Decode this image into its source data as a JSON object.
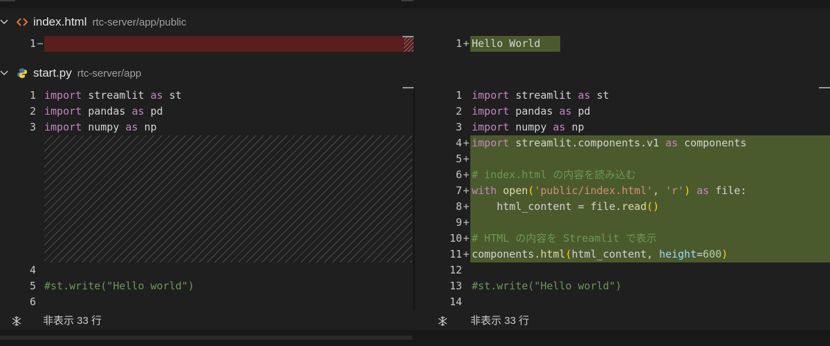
{
  "files": [
    {
      "name": "index.html",
      "path": "rtc-server/app/public",
      "icon": "html-file-icon",
      "left_lines": [
        {
          "n": "1",
          "mark": "−",
          "text": ""
        }
      ],
      "right_lines": [
        {
          "n": "1",
          "mark": "+",
          "text": "Hello World"
        }
      ]
    },
    {
      "name": "start.py",
      "path": "rtc-server/app",
      "icon": "python-file-icon",
      "left_numbers": [
        "1",
        "2",
        "3",
        "4",
        "5",
        "6"
      ],
      "right_numbers": [
        "1",
        "2",
        "3",
        "4",
        "5",
        "6",
        "7",
        "8",
        "9",
        "10",
        "11",
        "12",
        "13",
        "14"
      ],
      "diff_marker": "+",
      "code": {
        "import": "import",
        "as": "as",
        "streamlit": "streamlit",
        "st": "st",
        "pandas": "pandas",
        "pd": "pd",
        "numpy": "numpy",
        "np": "np",
        "components_module": "streamlit.components.v1",
        "components": "components",
        "comment1": "# index.html の内容を読み込む",
        "with": "with",
        "open": "open",
        "open_paren": "(",
        "path_arg": "'public/index.html'",
        "comma_sp": ", ",
        "mode_arg": "'r'",
        "close_paren": ")",
        "file_colon": "file:",
        "indent_assign": "    html_content = file.",
        "read": "read",
        "call_parens": "()",
        "comment2": "# HTML の内容を Streamlit で表示",
        "components_dot": "components.",
        "html_fn": "html",
        "html_arg": "html_content, ",
        "height": "height",
        "equals": "=",
        "value_600": "600",
        "st_write": "#st.write(\"Hello world\")"
      }
    }
  ],
  "footer": {
    "left": "非表示 33 行",
    "right": "非表示 33 行",
    "icon": "unfold-icon"
  }
}
